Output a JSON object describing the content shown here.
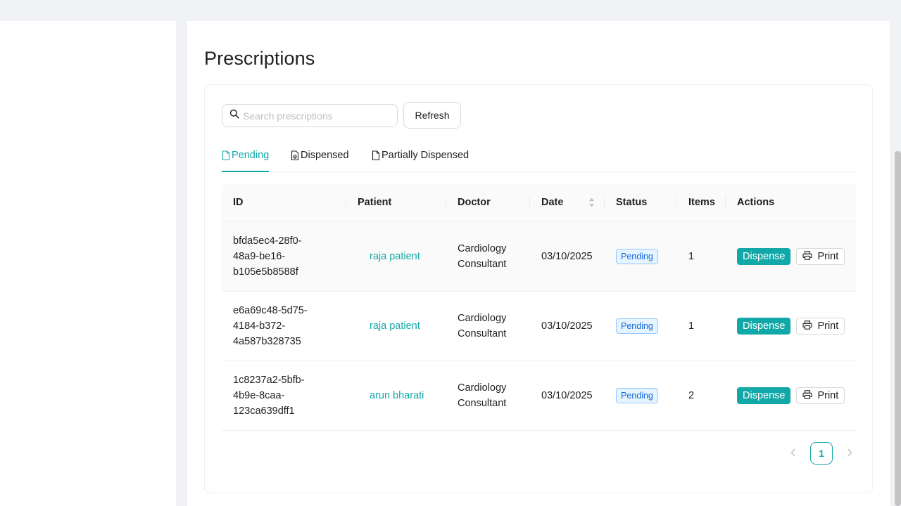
{
  "page": {
    "title": "Prescriptions"
  },
  "toolbar": {
    "search_placeholder": "Search prescriptions",
    "refresh_label": "Refresh"
  },
  "tabs": [
    {
      "label": "Pending",
      "active": true,
      "icon": "file-icon"
    },
    {
      "label": "Dispensed",
      "active": false,
      "icon": "file-check-icon"
    },
    {
      "label": "Partially Dispensed",
      "active": false,
      "icon": "file-icon"
    }
  ],
  "table": {
    "columns": [
      "ID",
      "Patient",
      "Doctor",
      "Date",
      "Status",
      "Items",
      "Actions"
    ],
    "rows": [
      {
        "id": "bfda5ec4-28f0-\n48a9-be16-\nb105e5b8588f",
        "patient": "raja patient",
        "doctor": "Cardiology\nConsultant",
        "date": "03/10/2025",
        "status": "Pending",
        "items": "1",
        "dispense_label": "Dispense",
        "print_label": "Print"
      },
      {
        "id": "e6a69c48-5d75-\n4184-b372-\n4a587b328735",
        "patient": "raja patient",
        "doctor": "Cardiology\nConsultant",
        "date": "03/10/2025",
        "status": "Pending",
        "items": "1",
        "dispense_label": "Dispense",
        "print_label": "Print"
      },
      {
        "id": "1c8237a2-5bfb-\n4b9e-8caa-\n123ca639dff1",
        "patient": "arun bharati",
        "doctor": "Cardiology\nConsultant",
        "date": "03/10/2025",
        "status": "Pending",
        "items": "2",
        "dispense_label": "Dispense",
        "print_label": "Print"
      }
    ]
  },
  "pagination": {
    "current_page": "1"
  },
  "colors": {
    "accent": "#13a8a8",
    "badge_text": "#1668dc",
    "badge_bg": "#e6f4ff"
  }
}
